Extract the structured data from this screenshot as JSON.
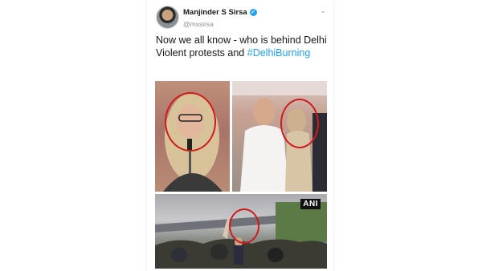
{
  "tweet": {
    "display_name": "Manjinder S Sirsa",
    "handle": "@mssirsa",
    "text_plain": "Now we all know - who is behind Delhi Violent protests and",
    "hashtag": "#DelhiBurning",
    "verified_icon": "verified-badge-icon",
    "menu_icon": "chevron-down-icon"
  },
  "photos": {
    "watermark": "ANI",
    "highlight_color": "#d11a1a"
  },
  "colors": {
    "link": "#1da1f2",
    "text": "#14171a",
    "muted": "#8a8f96"
  }
}
